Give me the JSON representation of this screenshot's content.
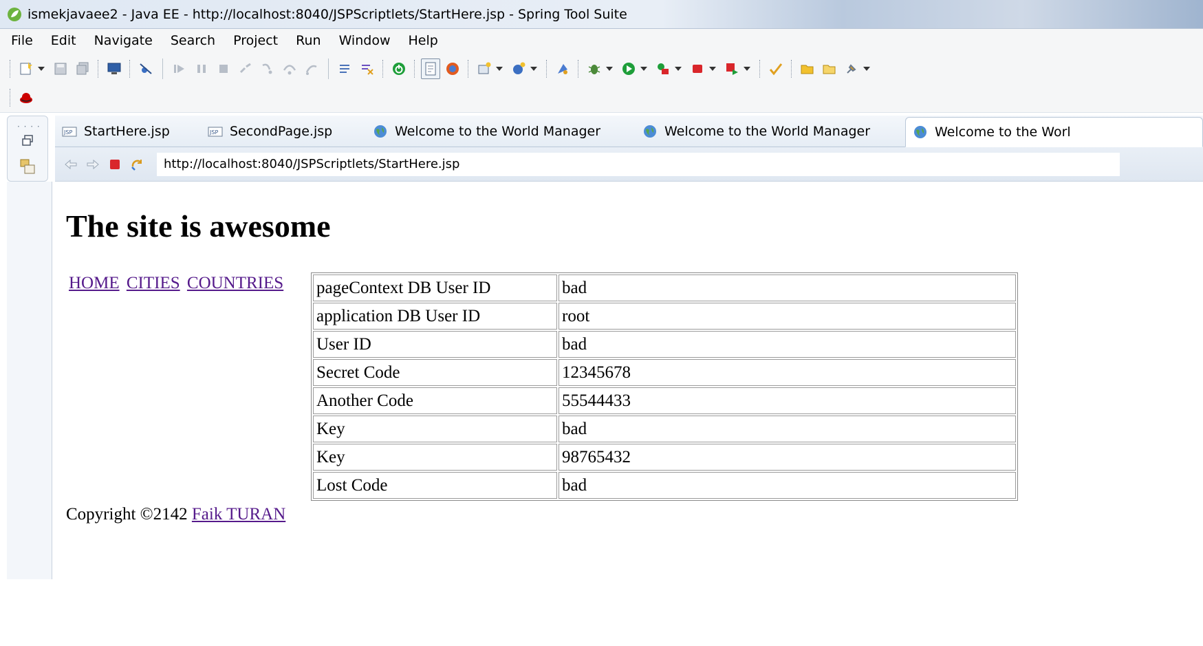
{
  "window": {
    "title": "ismekjavaee2 - Java EE - http://localhost:8040/JSPScriptlets/StartHere.jsp - Spring Tool Suite"
  },
  "menu": [
    "File",
    "Edit",
    "Navigate",
    "Search",
    "Project",
    "Run",
    "Window",
    "Help"
  ],
  "tabs": [
    {
      "label": "StartHere.jsp",
      "icon": "jsp-file-icon",
      "active": false
    },
    {
      "label": "SecondPage.jsp",
      "icon": "jsp-file-icon",
      "active": false
    },
    {
      "label": "Welcome to the World Manager",
      "icon": "globe-icon",
      "active": false
    },
    {
      "label": "Welcome to the World Manager",
      "icon": "globe-icon",
      "active": false
    },
    {
      "label": "Welcome to the Worl",
      "icon": "globe-icon",
      "active": true
    }
  ],
  "browser": {
    "url": "http://localhost:8040/JSPScriptlets/StartHere.jsp"
  },
  "page": {
    "title": "The site is awesome",
    "links": [
      "HOME",
      "CITIES",
      "COUNTRIES"
    ],
    "table": [
      {
        "key": "pageContext DB User ID",
        "value": "bad"
      },
      {
        "key": "application DB User ID",
        "value": "root"
      },
      {
        "key": "User ID",
        "value": "bad"
      },
      {
        "key": "Secret Code",
        "value": "12345678"
      },
      {
        "key": "Another Code",
        "value": "55544433"
      },
      {
        "key": "Key",
        "value": "bad"
      },
      {
        "key": "Key",
        "value": "98765432"
      },
      {
        "key": "Lost Code",
        "value": "bad"
      }
    ],
    "footer": {
      "text": "Copyright ©2142",
      "link": "Faik TURAN"
    }
  },
  "colors": {
    "visited_link": "#551a8b",
    "stop_red": "#d9262b",
    "run_green": "#1e9e3a"
  }
}
